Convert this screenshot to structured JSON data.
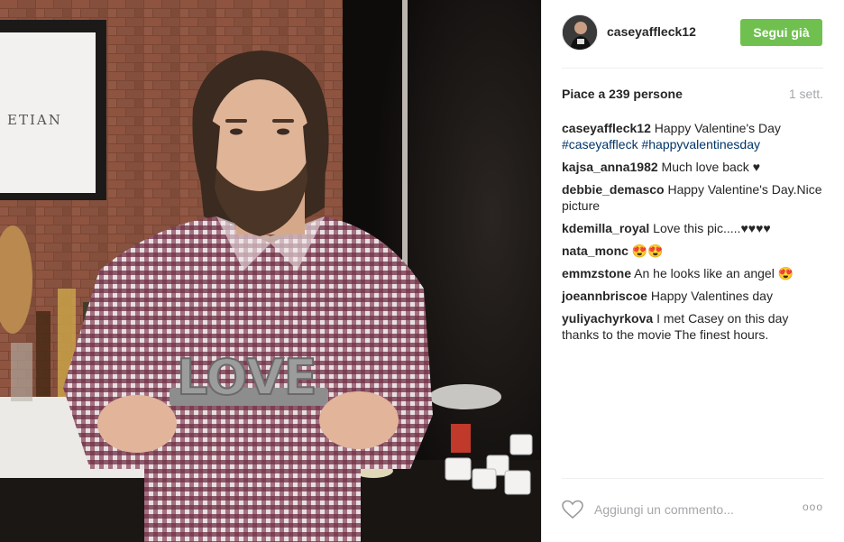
{
  "post": {
    "username": "caseyaffleck12",
    "follow_label": "Segui già",
    "likes_text": "Piace a 239 persone",
    "time_text": "1 sett.",
    "caption": {
      "user": "caseyaffleck12",
      "text": "Happy Valentine's Day",
      "hashtags": "#caseyaffleck #happyvalentinesday"
    },
    "photo": {
      "sign_text": "LOVE",
      "wall_sign_text": "ETIAN"
    }
  },
  "comments": [
    {
      "user": "kajsa_anna1982",
      "text": "Much love back ♥"
    },
    {
      "user": "debbie_demasco",
      "text": "Happy Valentine's Day.Nice picture"
    },
    {
      "user": "kdemilla_royal",
      "text": "Love this pic.....♥♥♥♥"
    },
    {
      "user": "nata_monc",
      "text": "😍😍"
    },
    {
      "user": "emmzstone",
      "text": "An he looks like an angel 😍"
    },
    {
      "user": "joeannbriscoe",
      "text": "Happy Valentines day"
    },
    {
      "user": "yuliyachyrkova",
      "text": "I met Casey on this day thanks to the movie The finest hours."
    }
  ],
  "footer": {
    "comment_placeholder": "Aggiungi un commento...",
    "more_label": "ooo"
  },
  "colors": {
    "follow_button": "#70c050",
    "hashtag": "#003569",
    "muted": "#a5a7aa"
  }
}
